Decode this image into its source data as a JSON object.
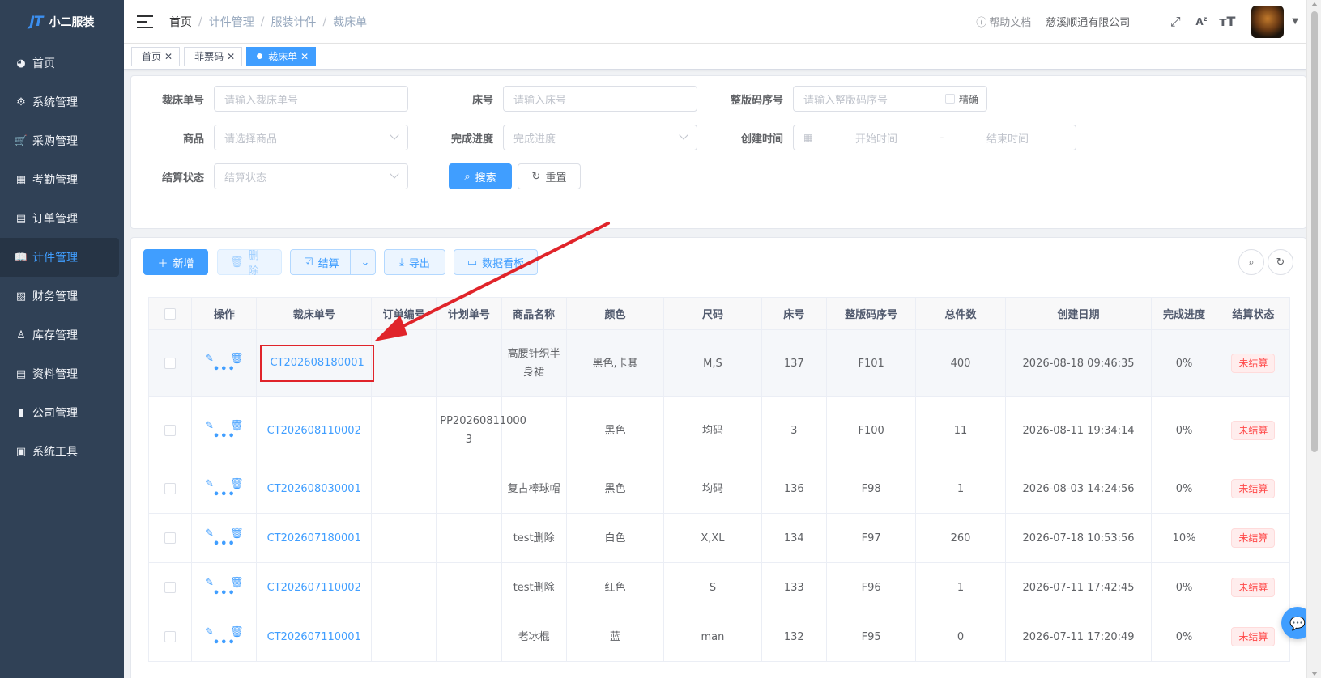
{
  "app": {
    "logo_mark": "JT",
    "name": "小二服装"
  },
  "sidebar": {
    "items": [
      {
        "label": "首页",
        "icon": "dashboard-icon",
        "glyph": "◕"
      },
      {
        "label": "系统管理",
        "icon": "gear-icon",
        "glyph": "⚙"
      },
      {
        "label": "采购管理",
        "icon": "cart-icon",
        "glyph": "🛒"
      },
      {
        "label": "考勤管理",
        "icon": "grid-icon",
        "glyph": "▦"
      },
      {
        "label": "订单管理",
        "icon": "order-icon",
        "glyph": "▤"
      },
      {
        "label": "计件管理",
        "icon": "book-icon",
        "glyph": "📖",
        "active": true
      },
      {
        "label": "财务管理",
        "icon": "chart-icon",
        "glyph": "▨"
      },
      {
        "label": "库存管理",
        "icon": "user-icon",
        "glyph": "♙"
      },
      {
        "label": "资料管理",
        "icon": "document-icon",
        "glyph": "▤"
      },
      {
        "label": "公司管理",
        "icon": "bar-chart-icon",
        "glyph": "▮"
      },
      {
        "label": "系统工具",
        "icon": "toolbox-icon",
        "glyph": "▣"
      }
    ]
  },
  "navbar": {
    "breadcrumb": [
      "首页",
      "计件管理",
      "服装计件",
      "裁床单"
    ],
    "help": "帮助文档",
    "company": "慈溪顺通有限公司"
  },
  "tags": [
    {
      "label": "首页",
      "active": false
    },
    {
      "label": "菲票码",
      "active": false
    },
    {
      "label": "裁床单",
      "active": true
    }
  ],
  "search": {
    "cut_no": {
      "label": "裁床单号",
      "placeholder": "请输入裁床单号"
    },
    "bed_no": {
      "label": "床号",
      "placeholder": "请输入床号"
    },
    "batch_seq": {
      "label": "整版码序号",
      "placeholder": "请输入整版码序号",
      "precise": "精确"
    },
    "product": {
      "label": "商品",
      "placeholder": "请选择商品"
    },
    "progress": {
      "label": "完成进度",
      "placeholder": "完成进度"
    },
    "created": {
      "label": "创建时间",
      "start": "开始时间",
      "sep": "-",
      "end": "结束时间"
    },
    "settle": {
      "label": "结算状态",
      "placeholder": "结算状态"
    },
    "search_btn": "搜索",
    "reset_btn": "重置"
  },
  "toolbar": {
    "add": "新增",
    "delete": "删除",
    "settle": "结算",
    "export": "导出",
    "dashboard": "数据看板"
  },
  "table": {
    "headers": [
      "操作",
      "裁床单号",
      "订单编号",
      "计划单号",
      "商品名称",
      "颜色",
      "尺码",
      "床号",
      "整版码序号",
      "总件数",
      "创建日期",
      "完成进度",
      "结算状态"
    ],
    "rows": [
      {
        "cut_no": "CT202608180001",
        "order_no": "",
        "plan_no": "",
        "product": "高腰针织半身裙",
        "color": "黑色,卡其",
        "size": "M,S",
        "bed": "137",
        "seq": "F101",
        "total": "400",
        "created": "2026-08-18 09:46:35",
        "progress": "0%",
        "status": "未结算"
      },
      {
        "cut_no": "CT202608110002",
        "order_no": "",
        "plan_no": "PP20260811000 3",
        "product": "",
        "color": "黑色",
        "size": "均码",
        "bed": "3",
        "seq": "F100",
        "total": "11",
        "created": "2026-08-11 19:34:14",
        "progress": "0%",
        "status": "未结算"
      },
      {
        "cut_no": "CT202608030001",
        "order_no": "",
        "plan_no": "",
        "product": "复古棒球帽",
        "color": "黑色",
        "size": "均码",
        "bed": "136",
        "seq": "F98",
        "total": "1",
        "created": "2026-08-03 14:24:56",
        "progress": "0%",
        "status": "未结算"
      },
      {
        "cut_no": "CT202607180001",
        "order_no": "",
        "plan_no": "",
        "product": "test删除",
        "color": "白色",
        "size": "X,XL",
        "bed": "134",
        "seq": "F97",
        "total": "260",
        "created": "2026-07-18 10:53:56",
        "progress": "10%",
        "status": "未结算"
      },
      {
        "cut_no": "CT202607110002",
        "order_no": "",
        "plan_no": "",
        "product": "test删除",
        "color": "红色",
        "size": "S",
        "bed": "133",
        "seq": "F96",
        "total": "1",
        "created": "2026-07-11 17:42:45",
        "progress": "0%",
        "status": "未结算"
      },
      {
        "cut_no": "CT202607110001",
        "order_no": "",
        "plan_no": "",
        "product": "老冰棍",
        "color": "蓝",
        "size": "man",
        "bed": "132",
        "seq": "F95",
        "total": "0",
        "created": "2026-07-11 17:20:49",
        "progress": "0%",
        "status": "未结算"
      }
    ]
  },
  "colors": {
    "primary": "#409eff",
    "sidebar_bg": "#304156",
    "annotation": "#e0242a",
    "danger": "#ff4949"
  }
}
